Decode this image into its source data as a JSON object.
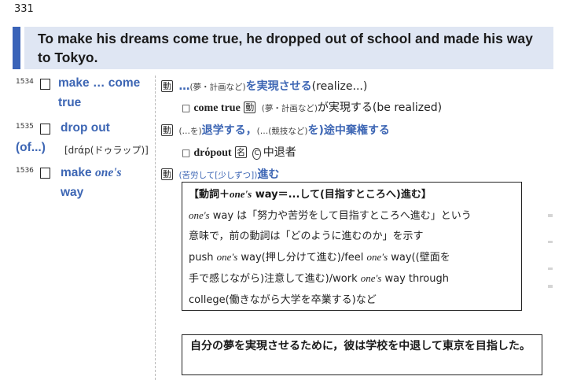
{
  "page_number": "331",
  "sentence": "To make his dreams come true, he dropped out of school and made his way to Tokyo.",
  "entries": [
    {
      "num": "1534",
      "headword_l1": "make … come",
      "headword_l2": "true",
      "def_pos": "動",
      "def_pre": "…",
      "def_note": "(夢・計画など)",
      "def_main": "を実現させる",
      "def_paren": "(realize...)",
      "sub_box": "□",
      "sub_word": "come true",
      "sub_pos": "動",
      "sub_note": "(夢・計画など)",
      "sub_rest": "が実現する(be realized)"
    },
    {
      "num": "1535",
      "headword_l1": "drop out",
      "headword_l2": "(of...)",
      "pron": "[drάp(ドゥラップ)]",
      "def_pos": "動",
      "def_note1": "(…を)",
      "def_main1": "退学する，",
      "def_note2": "(…(競技など)",
      "def_main2": "を)途中棄権する",
      "sub_box": "□",
      "sub_word": "drόpout",
      "sub_pos": "名",
      "sub_pos2": "C",
      "sub_rest": "中退者"
    },
    {
      "num": "1536",
      "headword_l1": "make",
      "headword_italic": "one's",
      "headword_l2": "way",
      "def_pos": "動",
      "def_note": "(苦労して[少しずつ])",
      "def_main": "進む"
    }
  ],
  "note_box": {
    "heading_pre": "【動詞＋",
    "heading_italic": "one's",
    "heading_post": " way＝...して(目指すところへ)進む】",
    "line1_italic": "one's",
    "line1": " way は「努力や苦労をして目指すところへ進む」という",
    "line2": "意味で，前の動詞は「どのように進むのか」を示す",
    "line3a": "push ",
    "line3i1": "one's",
    "line3b": " way(押し分けて進む)/feel ",
    "line3i2": "one's",
    "line3c": " way((壁面を",
    "line4a": "手で感じながら)注意して進む)/work ",
    "line4i": "one's",
    "line4b": " way through",
    "line5": "college(働きながら大学を卒業する)など"
  },
  "translation": "自分の夢を実現させるために，彼は学校を中退して東京を目指した。"
}
